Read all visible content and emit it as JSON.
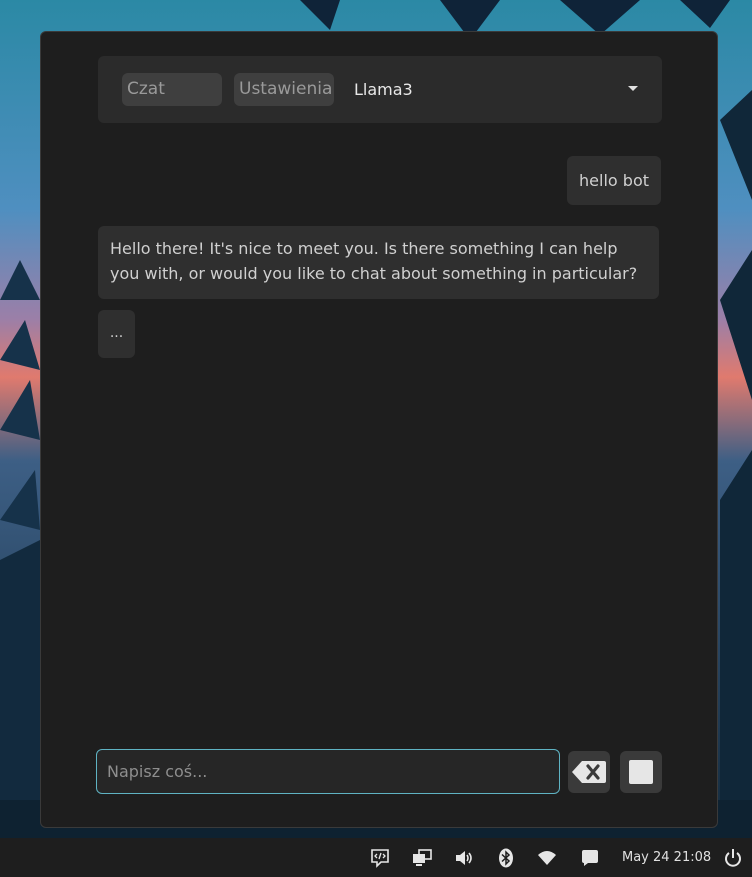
{
  "app": {
    "tabs": {
      "chat_label": "Czat",
      "settings_label": "Ustawienia"
    },
    "model": {
      "selected": "Llama3"
    }
  },
  "messages": [
    {
      "role": "user",
      "text": "hello bot"
    },
    {
      "role": "assistant",
      "text": "Hello there! It's nice to meet you. Is there something I can help\nyou with, or would you like to chat about something in particular?"
    },
    {
      "role": "assistant-typing",
      "text": "..."
    }
  ],
  "composer": {
    "placeholder": "Napisz coś...",
    "value": ""
  },
  "taskbar": {
    "clock": "May 24 21:08",
    "icons": [
      "code-chat-icon",
      "display-icon",
      "volume-icon",
      "bluetooth-icon",
      "wifi-icon",
      "notification-icon",
      "power-icon"
    ]
  },
  "colors": {
    "window_bg": "#1e1e1e",
    "bubble_bg": "#2f2f2f",
    "input_focus_border": "#5fb3c3",
    "taskbar_bg": "#1e1e1e"
  }
}
